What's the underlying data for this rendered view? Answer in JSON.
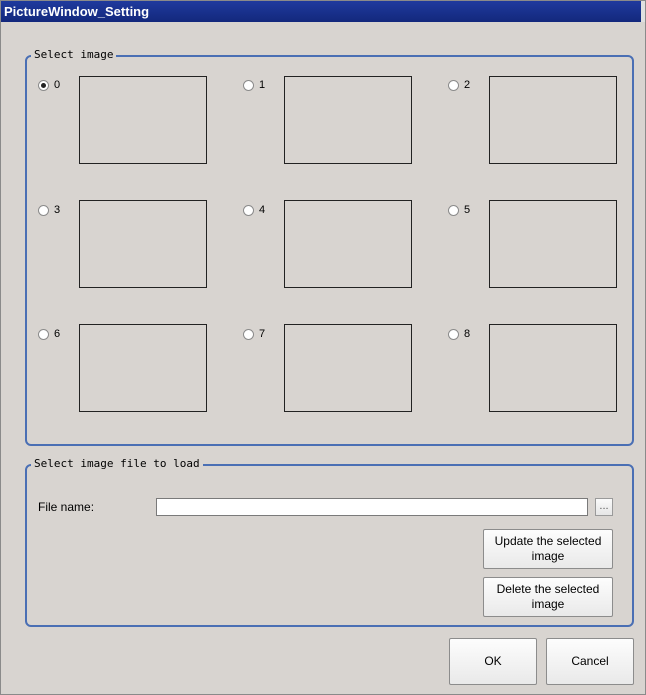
{
  "window": {
    "title": "PictureWindow_Setting"
  },
  "select_image": {
    "legend": "Select image",
    "selected": "0",
    "options": [
      {
        "label": "0",
        "checked": true
      },
      {
        "label": "1",
        "checked": false
      },
      {
        "label": "2",
        "checked": false
      },
      {
        "label": "3",
        "checked": false
      },
      {
        "label": "4",
        "checked": false
      },
      {
        "label": "5",
        "checked": false
      },
      {
        "label": "6",
        "checked": false
      },
      {
        "label": "7",
        "checked": false
      },
      {
        "label": "8",
        "checked": false
      }
    ]
  },
  "load_file": {
    "legend": "Select image file to load",
    "file_name_label": "File name:",
    "file_name_value": "",
    "browse_label": "...",
    "update_label": "Update the selected image",
    "delete_label": "Delete the selected image"
  },
  "footer": {
    "ok_label": "OK",
    "cancel_label": "Cancel"
  },
  "colors": {
    "title_bg": "#1a3390",
    "group_border": "#4a6fb4",
    "window_bg": "#d8d4d0"
  }
}
